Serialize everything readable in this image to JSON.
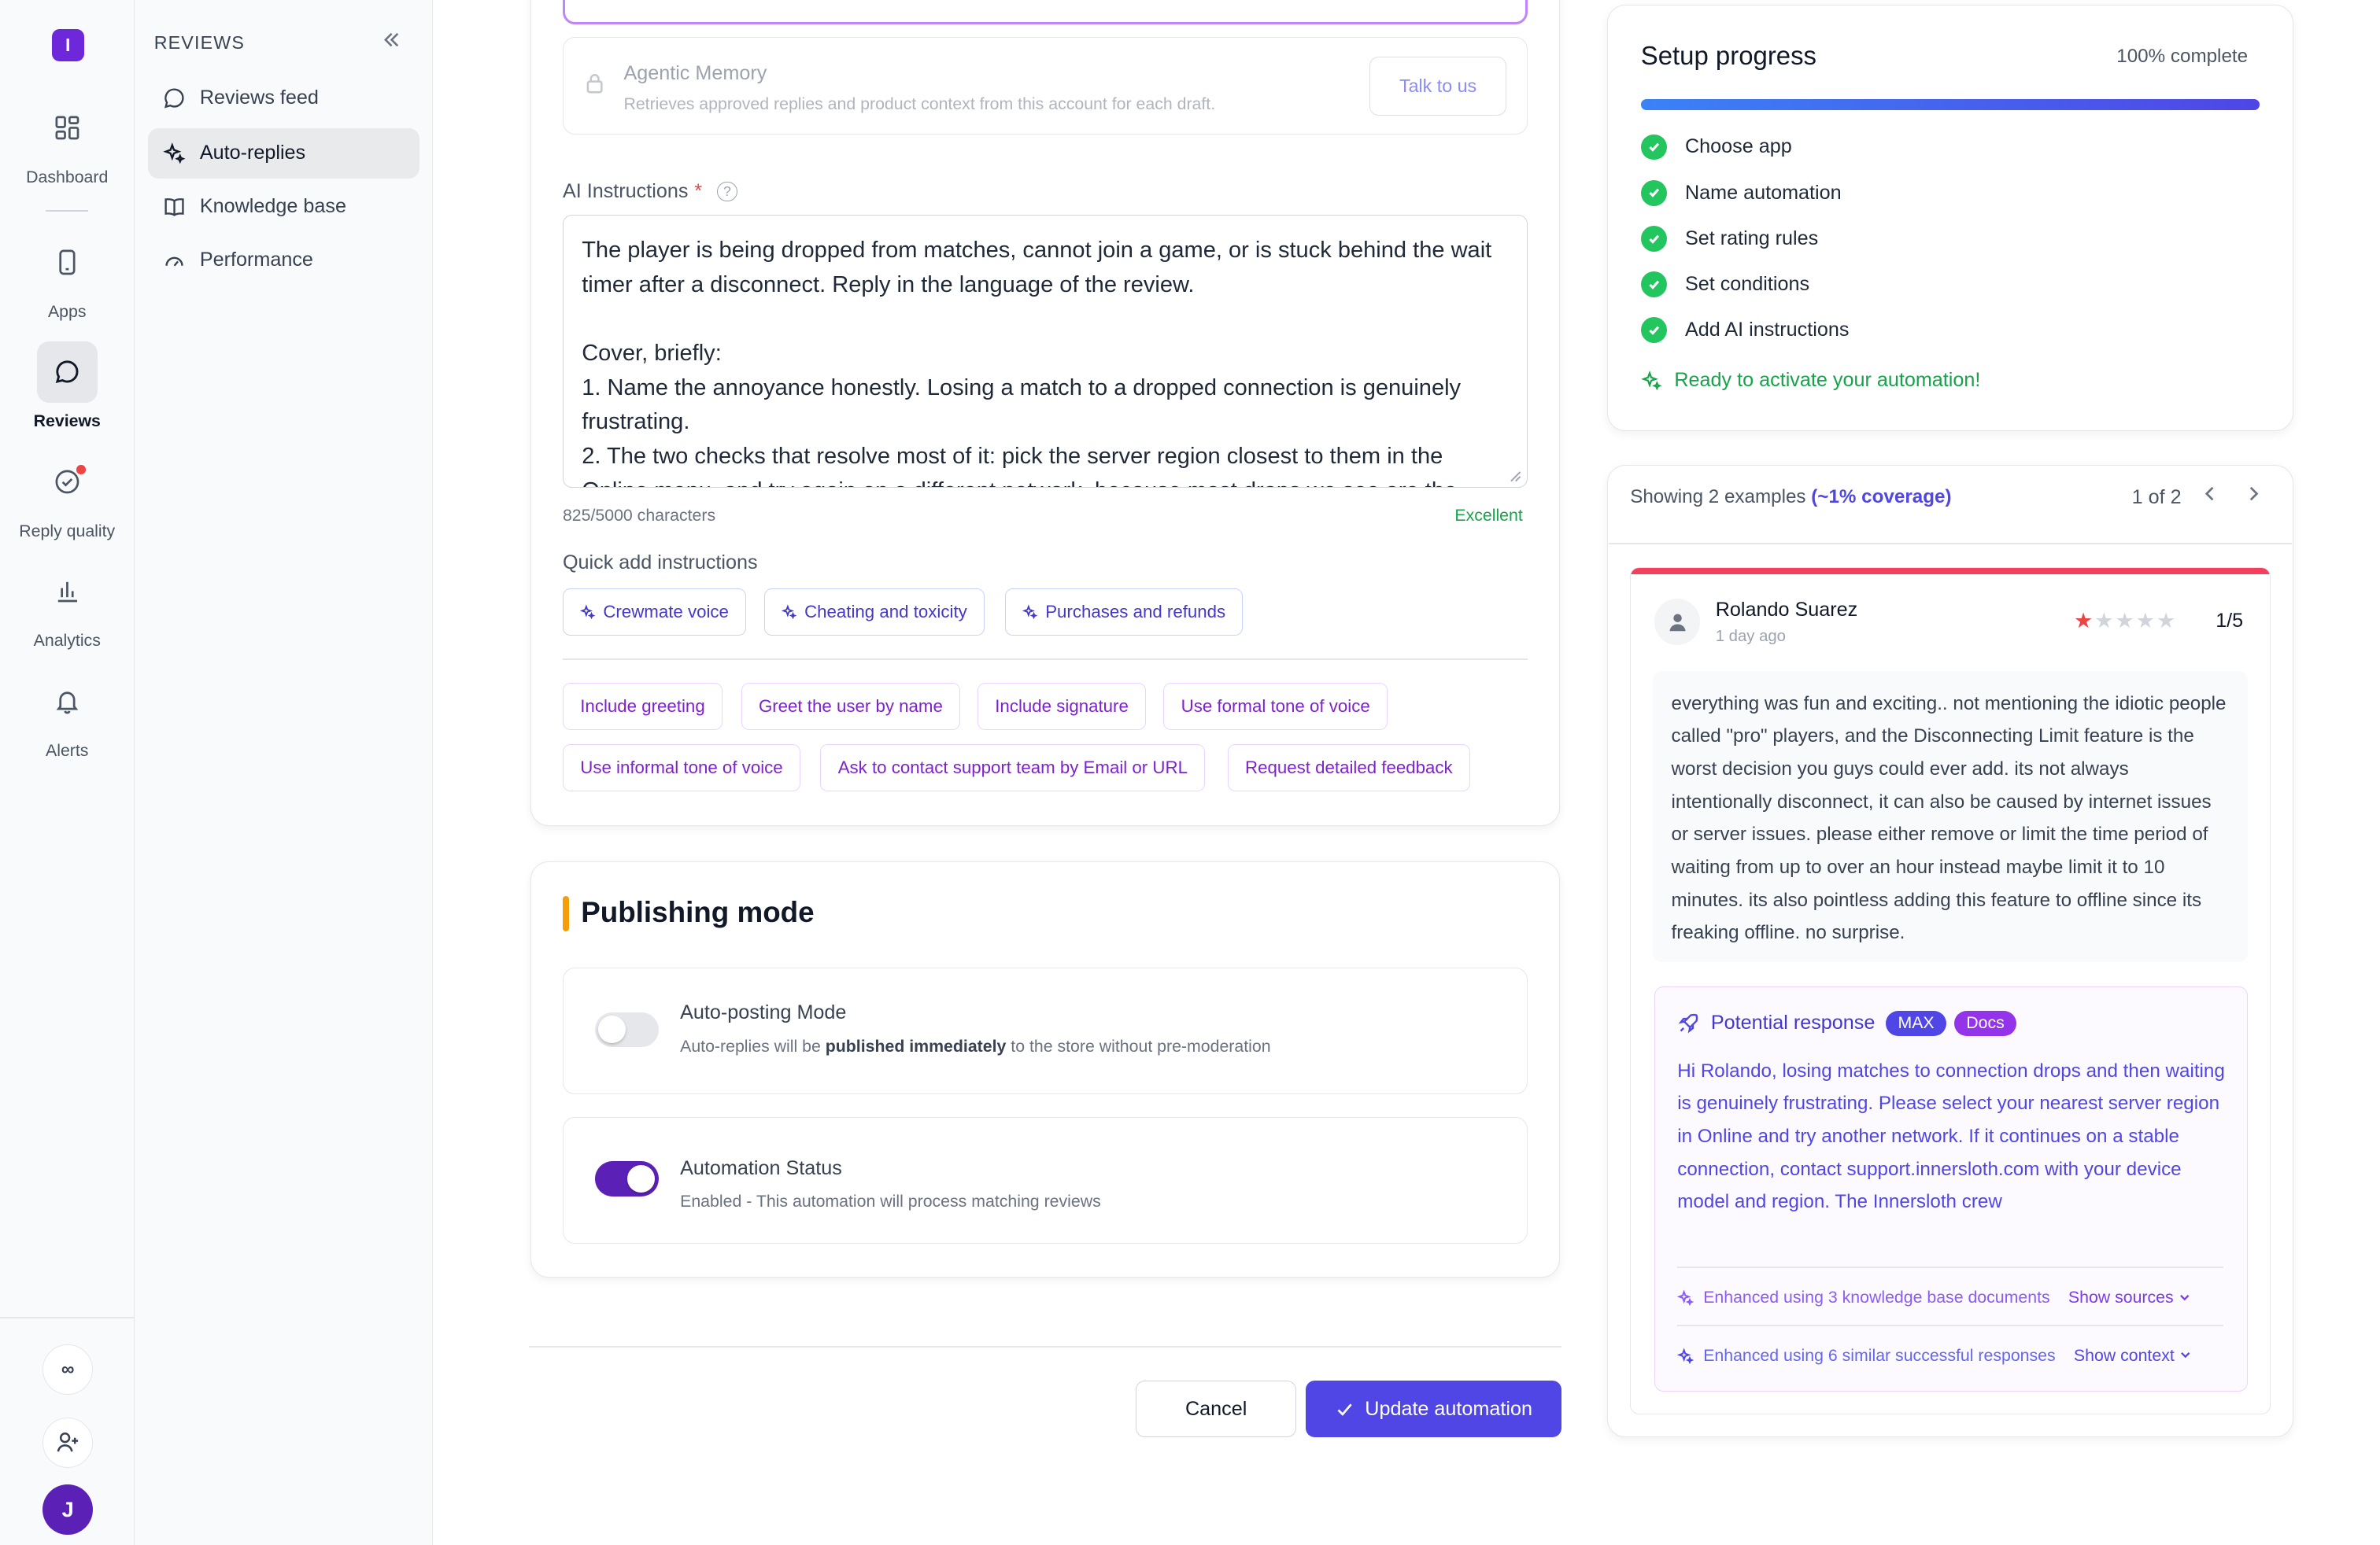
{
  "app": {
    "logo_letter": "I"
  },
  "rail": {
    "items": [
      {
        "label": "Dashboard",
        "icon": "grid-icon"
      },
      {
        "label": "Apps",
        "icon": "phone-icon"
      },
      {
        "label": "Reviews",
        "icon": "chat-bubble-icon",
        "active": true
      },
      {
        "label": "Reply quality",
        "icon": "check-circle-icon"
      },
      {
        "label": "Analytics",
        "icon": "bar-chart-icon"
      },
      {
        "label": "Alerts",
        "icon": "bell-icon"
      }
    ],
    "infinity_label": "∞",
    "avatar_letter": "J"
  },
  "sidenav": {
    "title": "REVIEWS",
    "items": [
      {
        "label": "Reviews feed",
        "icon": "chat-icon"
      },
      {
        "label": "Auto-replies",
        "icon": "sparkle-icon",
        "active": true
      },
      {
        "label": "Knowledge base",
        "icon": "book-icon"
      },
      {
        "label": "Performance",
        "icon": "gauge-icon"
      }
    ]
  },
  "memory": {
    "title": "Agentic Memory",
    "description": "Retrieves approved replies and product context from this account for each draft.",
    "button": "Talk to us"
  },
  "instructions": {
    "label": "AI Instructions",
    "required_mark": "*",
    "help_mark": "?",
    "value": "The player is being dropped from matches, cannot join a game, or is stuck behind the wait timer after a disconnect. Reply in the language of the review.\n\nCover, briefly:\n1. Name the annoyance honestly. Losing a match to a dropped connection is genuinely frustrating.\n2. The two checks that resolve most of it: pick the server region closest to them in the Online menu, and try again on a different network, because most drops we see are the",
    "char_count": "825/5000 characters",
    "quality": "Excellent"
  },
  "quick_add": {
    "label": "Quick add instructions",
    "sparkle_chips": [
      "Crewmate voice",
      "Cheating and toxicity",
      "Purchases and refunds"
    ],
    "chips": [
      "Include greeting",
      "Greet the user by name",
      "Include signature",
      "Use formal tone of voice",
      "Use informal tone of voice",
      "Ask to contact support team by Email or URL",
      "Request detailed feedback"
    ]
  },
  "publishing": {
    "title": "Publishing mode",
    "auto_post": {
      "title": "Auto-posting Mode",
      "desc_prefix": "Auto-replies will be ",
      "desc_bold": "published immediately",
      "desc_suffix": " to the store without pre-moderation",
      "enabled": false
    },
    "status": {
      "title": "Automation Status",
      "desc": "Enabled - This automation will process matching reviews",
      "enabled": true
    }
  },
  "actions": {
    "cancel": "Cancel",
    "update": "Update automation"
  },
  "setup": {
    "title": "Setup progress",
    "percent_label": "100% complete",
    "progress": 1.0,
    "steps": [
      "Choose app",
      "Name automation",
      "Set rating rules",
      "Set conditions",
      "Add AI instructions"
    ],
    "ready": "Ready to activate your automation!"
  },
  "examples": {
    "showing_prefix": "Showing 2 examples ",
    "coverage": "(~1% coverage)",
    "pager": "1 of 2",
    "review": {
      "author": "Rolando Suarez",
      "time": "1 day ago",
      "rating": 1,
      "score": "1/5",
      "text": "everything was fun and exciting.. not mentioning the idiotic people called \"pro\" players, and the Disconnecting Limit feature is the worst decision you guys could ever add. its not always intentionally disconnect, it can also be caused by internet issues or server issues. please either remove or limit the time period of waiting from up to over an hour instead maybe limit it to 10 minutes. its also pointless adding this feature to offline since its freaking offline. no surprise."
    },
    "response": {
      "title": "Potential response",
      "badge_max": "MAX",
      "badge_docs": "Docs",
      "text": "Hi Rolando, losing matches to connection drops and then waiting is genuinely frustrating. Please select your nearest server region in Online and try another network. If it continues on a stable connection, contact support.innersloth.com with your device model and region. The Innersloth crew",
      "enhanced_kb": "Enhanced using 3 knowledge base documents",
      "show_sources": "Show sources",
      "enhanced_similar": "Enhanced using 6 similar successful responses",
      "show_context": "Show context"
    }
  },
  "colors": {
    "accent": "#4f46e5",
    "brand": "#6d28d9",
    "success": "#22c55e",
    "warning_bar": "#f59e0b",
    "review_top": "#f43f5e"
  }
}
